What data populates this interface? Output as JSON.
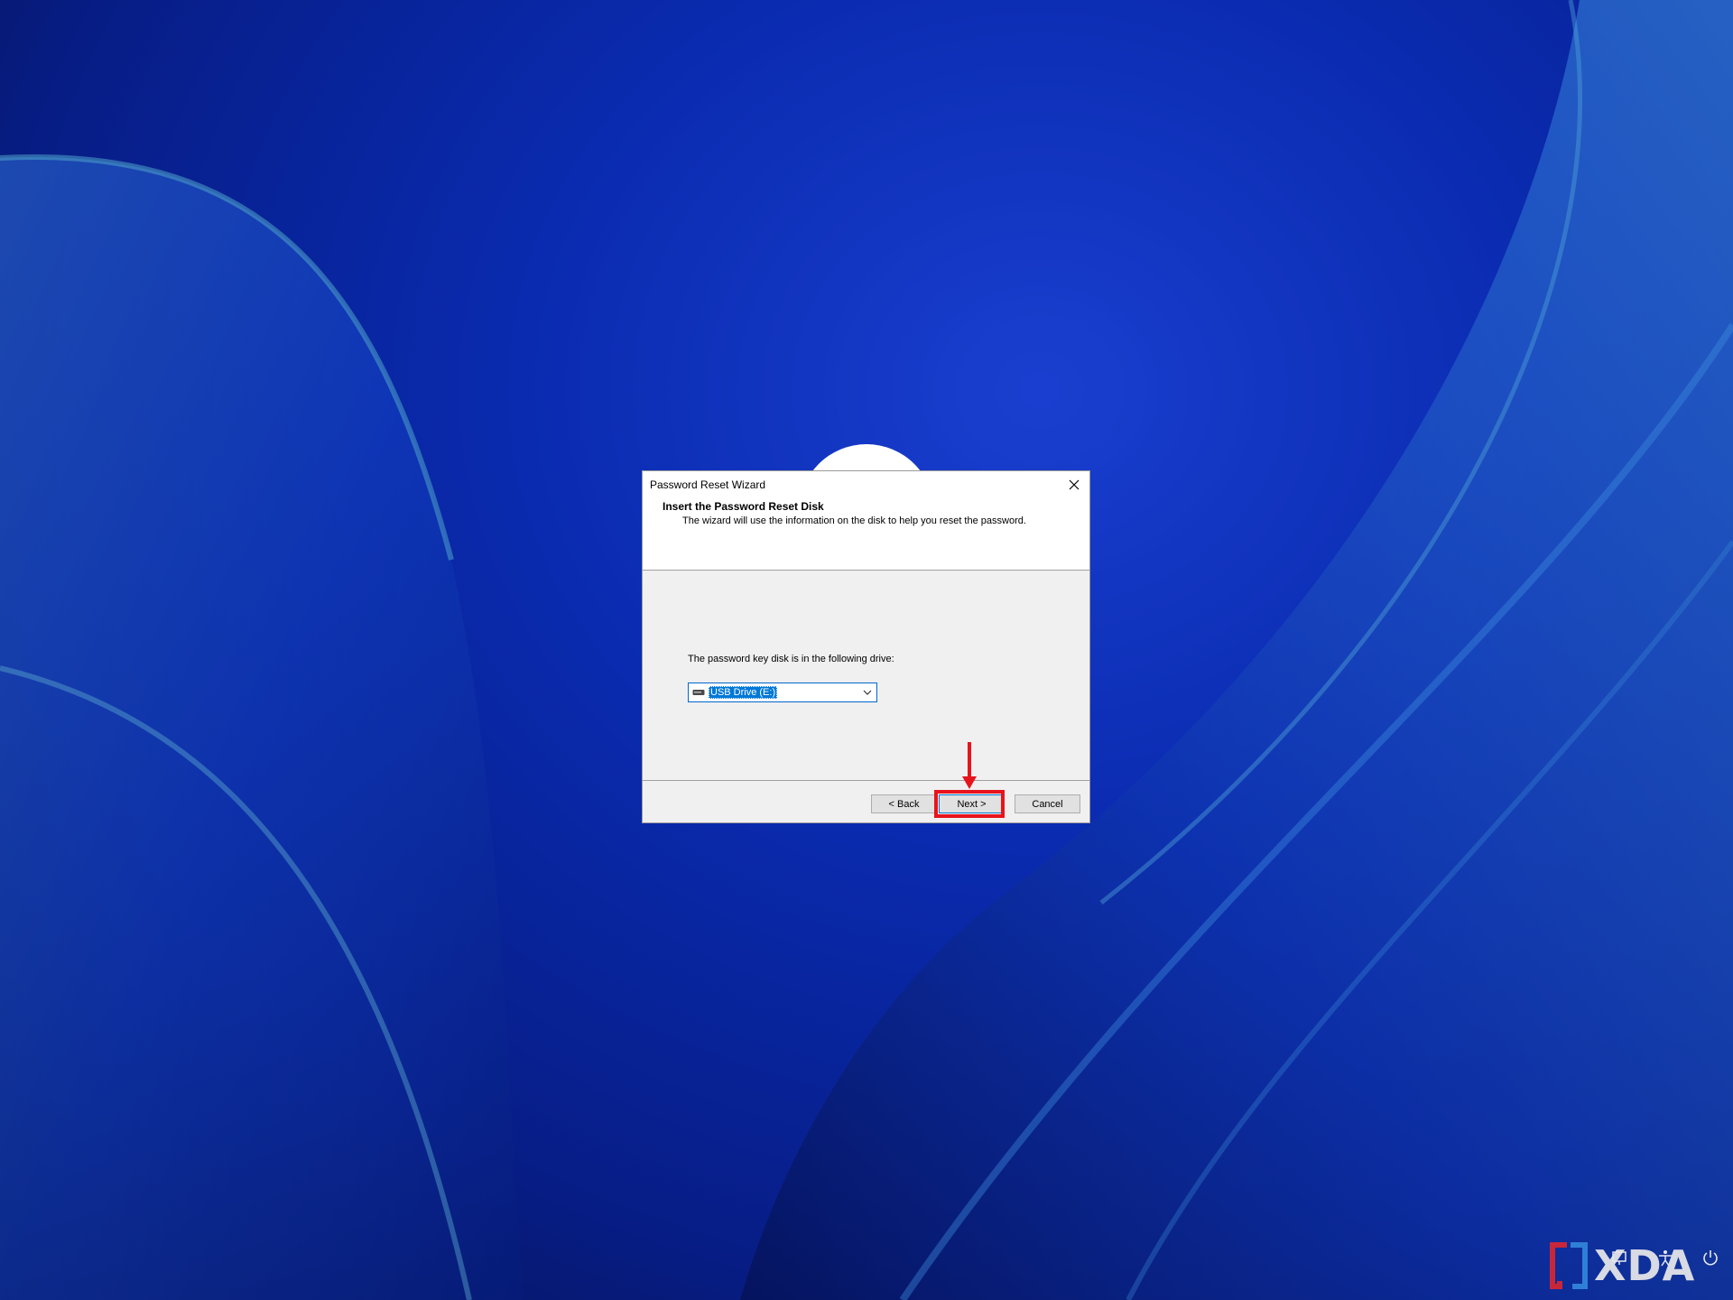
{
  "dialog": {
    "title": "Password Reset Wizard",
    "heading": "Insert the Password Reset Disk",
    "subheading": "The wizard will use the information on the disk to help you reset the password.",
    "drive_label": "The password key disk is in the following drive:",
    "selected_drive": "USB Drive (E:)",
    "buttons": {
      "back": "< Back",
      "next": "Next >",
      "cancel": "Cancel"
    }
  },
  "watermark": {
    "text": "XDA"
  },
  "colors": {
    "highlight": "#e8141c",
    "selection": "#0078d7",
    "wallpaper": "#0a2bb0"
  },
  "icons": [
    "close-icon",
    "usb-drive-icon",
    "chevron-down-icon",
    "accessibility-icon",
    "network-icon",
    "power-icon"
  ]
}
